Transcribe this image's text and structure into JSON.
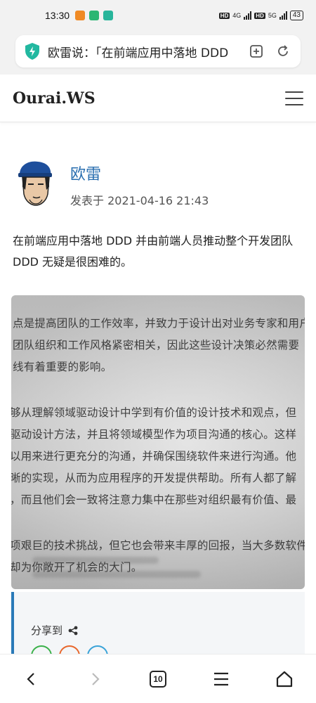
{
  "status_bar": {
    "time": "13:30",
    "network_1": "4G",
    "network_2": "5G",
    "hd_1": "HD",
    "hd_2": "HD",
    "battery": "43"
  },
  "browser": {
    "url_title": "欧雷说：「在前端应用中落地 DDD",
    "tab_count": "10",
    "accent": "#22b8a0"
  },
  "site": {
    "title": "Ourai.WS"
  },
  "post": {
    "author": "欧雷",
    "published": "发表于 2021-04-16 21:43",
    "intro": "在前端应用中落地 DDD 并由前端人员推动整个开发团队 DDD 无疑是很困难的。",
    "photo_lines": [
      "点是提高团队的工作效率，并致力于设计出对业务专家和用户",
      "团队组织和工作风格紧密相关，因此这些设计决策必然需要",
      "线有着重要的影响。",
      "",
      "够从理解领域驱动设计中学到有价值的设计技术和观点，但",
      "驱动设计方法，并且将领域模型作为项目沟通的核心。这样",
      "以用来进行更充分的沟通，并确保围绕软件来进行沟通。他",
      "晰的实现，从而为应用程序的开发提供帮助。所有人都了解",
      "，而且他们会一致将注意力集中在那些对组织最有价值、最",
      "",
      "项艰巨的技术挑战，但它也会带来丰厚的回报，当大多数软件",
      "却为你敞开了机会的大门。"
    ],
    "share_label": "分享到"
  },
  "colors": {
    "link": "#2a6fb0",
    "share_green": "#3bb14a",
    "share_orange": "#e8672c",
    "share_blue": "#3aa3d8"
  }
}
